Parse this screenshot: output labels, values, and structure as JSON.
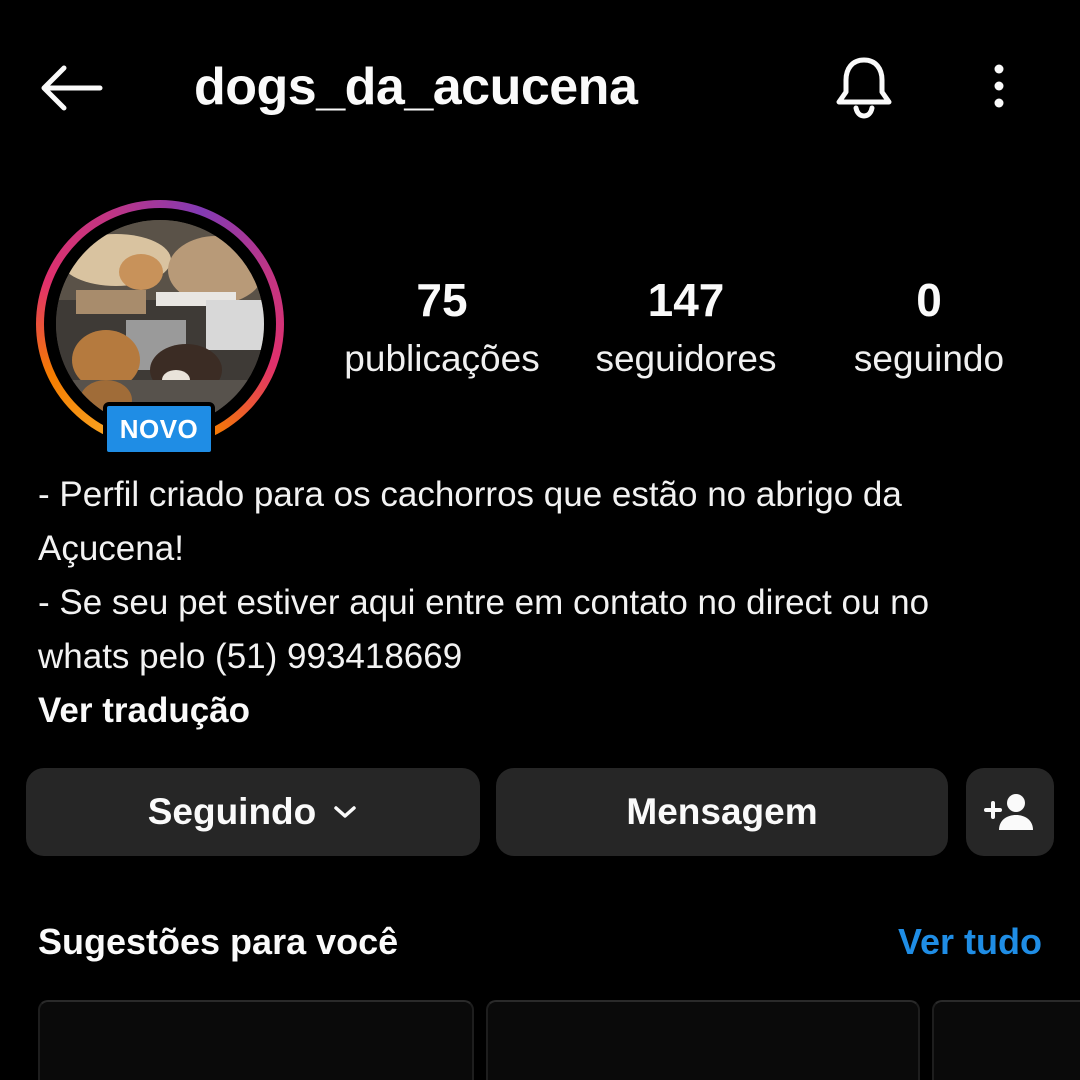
{
  "header": {
    "username": "dogs_da_acucena"
  },
  "profile": {
    "badge": "NOVO",
    "stats": [
      {
        "value": "75",
        "label": "publicações"
      },
      {
        "value": "147",
        "label": "seguidores"
      },
      {
        "value": "0",
        "label": "seguindo"
      }
    ],
    "bio_lines": [
      "- Perfil criado para os cachorros que estão no abrigo da",
      "Açucena!",
      "- Se seu pet estiver aqui entre em contato no direct ou no",
      "whats pelo (51) 993418669"
    ],
    "translate_label": "Ver tradução"
  },
  "actions": {
    "following_label": "Seguindo",
    "message_label": "Mensagem"
  },
  "suggestions": {
    "title": "Sugestões para você",
    "see_all_label": "Ver tudo"
  },
  "icons": {
    "back": "arrow-left-icon",
    "bell": "bell-icon",
    "more": "more-vertical-icon",
    "chevron": "chevron-down-icon",
    "add_person": "add-person-icon"
  },
  "colors": {
    "background": "#000000",
    "button": "#262626",
    "accent_blue": "#1f8de5",
    "text": "#fafafa"
  }
}
